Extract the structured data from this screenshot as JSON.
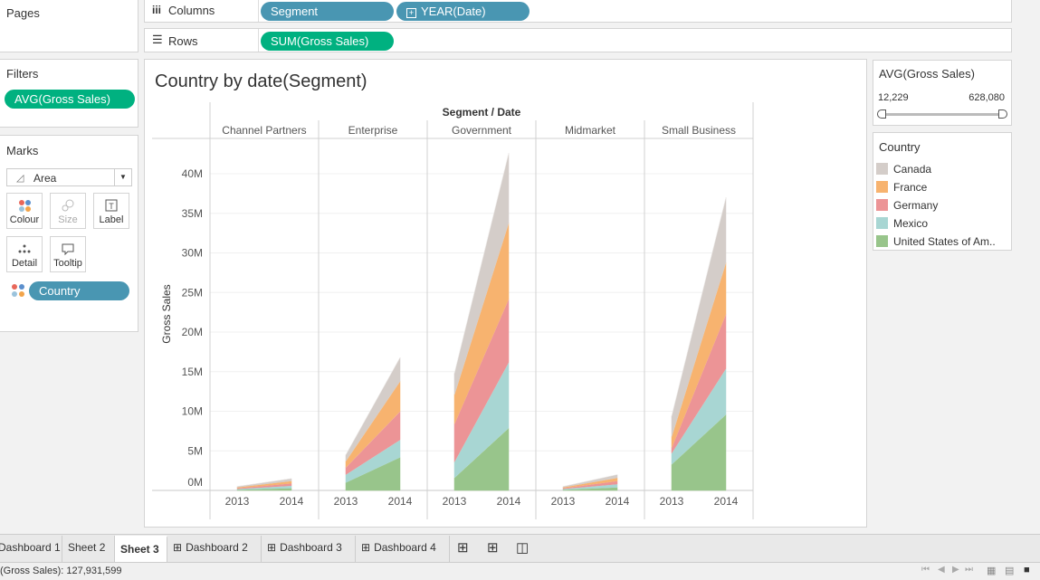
{
  "sidebar": {
    "pages_label": "Pages",
    "filters_label": "Filters",
    "filter_pill": "AVG(Gross Sales)",
    "marks_label": "Marks",
    "mark_type": "Area",
    "mark_buttons": [
      "Colour",
      "Size",
      "Label",
      "Detail",
      "Tooltip"
    ],
    "country_pill": "Country"
  },
  "shelves": {
    "columns_label": "Columns",
    "columns_pills": [
      "Segment",
      "YEAR(Date)"
    ],
    "rows_label": "Rows",
    "rows_pill": "SUM(Gross Sales)"
  },
  "right_panel": {
    "slider_title": "AVG(Gross Sales)",
    "slider_min": "12,229",
    "slider_max": "628,080",
    "legend_title": "Country",
    "legend": [
      {
        "label": "Canada",
        "color": "#d4cdc9"
      },
      {
        "label": "France",
        "color": "#f7b36f"
      },
      {
        "label": "Germany",
        "color": "#ec9496"
      },
      {
        "label": "Mexico",
        "color": "#a8d6d3"
      },
      {
        "label": "United States of Am..",
        "color": "#98c58b"
      }
    ]
  },
  "tabs": [
    "Dashboard 1",
    "Sheet 2",
    "Sheet 3",
    "Dashboard 2",
    "Dashboard 3",
    "Dashboard 4"
  ],
  "active_tab": "Sheet 3",
  "status": "(Gross Sales): 127,931,599",
  "chart_data": {
    "type": "area",
    "title": "Country by date(Segment)",
    "column_header": "Segment / Date",
    "ylabel": "Gross Sales",
    "ylim": [
      0,
      44
    ],
    "yticks": [
      "0M",
      "5M",
      "10M",
      "15M",
      "20M",
      "25M",
      "30M",
      "35M",
      "40M"
    ],
    "ytick_values": [
      0,
      5,
      10,
      15,
      20,
      25,
      30,
      35,
      40
    ],
    "x": [
      "2013",
      "2014"
    ],
    "segments": [
      "Channel Partners",
      "Enterprise",
      "Government",
      "Midmarket",
      "Small Business"
    ],
    "stack_order": [
      "United States of America",
      "Mexico",
      "Germany",
      "France",
      "Canada"
    ],
    "series": [
      {
        "segment": "Channel Partners",
        "values": {
          "United States of America": [
            0.1,
            0.3
          ],
          "Mexico": [
            0.1,
            0.3
          ],
          "Germany": [
            0.1,
            0.3
          ],
          "France": [
            0.1,
            0.3
          ],
          "Canada": [
            0.1,
            0.3
          ]
        }
      },
      {
        "segment": "Enterprise",
        "values": {
          "United States of America": [
            1.0,
            4.2
          ],
          "Mexico": [
            1.0,
            2.2
          ],
          "Germany": [
            0.9,
            3.6
          ],
          "France": [
            0.8,
            3.8
          ],
          "Canada": [
            0.8,
            3.0
          ]
        }
      },
      {
        "segment": "Government",
        "values": {
          "United States of America": [
            1.6,
            7.9
          ],
          "Mexico": [
            2.0,
            8.3
          ],
          "Germany": [
            4.8,
            8.0
          ],
          "France": [
            3.7,
            9.6
          ],
          "Canada": [
            2.7,
            8.8
          ]
        }
      },
      {
        "segment": "Midmarket",
        "values": {
          "United States of America": [
            0.1,
            0.4
          ],
          "Mexico": [
            0.1,
            0.4
          ],
          "Germany": [
            0.1,
            0.4
          ],
          "France": [
            0.1,
            0.4
          ],
          "Canada": [
            0.1,
            0.4
          ]
        }
      },
      {
        "segment": "Small Business",
        "values": {
          "United States of America": [
            3.3,
            9.6
          ],
          "Mexico": [
            1.4,
            5.8
          ],
          "Germany": [
            0.7,
            6.9
          ],
          "France": [
            1.4,
            6.5
          ],
          "Canada": [
            2.6,
            8.2
          ]
        }
      }
    ]
  }
}
